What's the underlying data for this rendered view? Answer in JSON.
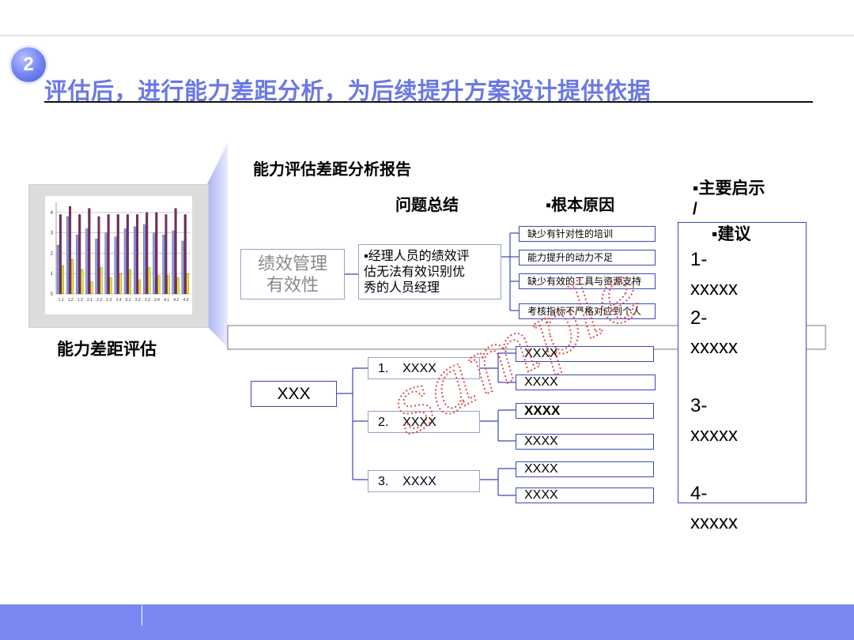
{
  "badge_number": "2",
  "title": "评估后，进行能力差距分析，为后续提升方案设计提供依据",
  "left_caption": "能力差距评估",
  "thumbnail_chart": {
    "type": "bar",
    "y_ticks": [
      "0",
      "1",
      "2",
      "3",
      "4"
    ],
    "x_labels": [
      "1.1",
      "1.2",
      "1.3",
      "2.1",
      "2.2",
      "2.3",
      "2.4",
      "3.1",
      "3.2",
      "3.3",
      "3.4",
      "4.1",
      "4.2",
      "4.3"
    ],
    "series": [
      {
        "values": [
          2.4,
          3.8,
          2.9,
          3.2,
          2.7,
          3.0,
          2.8,
          3.2,
          3.3,
          3.4,
          3.0,
          2.9,
          3.1,
          2.6
        ],
        "color": "#8e9be8"
      },
      {
        "values": [
          3.9,
          4.3,
          3.9,
          4.2,
          3.8,
          3.9,
          3.9,
          3.9,
          3.9,
          4.0,
          4.0,
          3.9,
          4.2,
          3.9
        ],
        "color": "#7a2a5e"
      },
      {
        "values": [
          1.4,
          1.7,
          1.2,
          0.6,
          1.3,
          0.8,
          1.0,
          1.2,
          0.7,
          1.3,
          0.9,
          0.9,
          0.8,
          1.0
        ],
        "color": "#f2e233"
      }
    ],
    "ylim": [
      0,
      4.5
    ]
  },
  "report": {
    "title": "能力评估差距分析报告",
    "col_summary": "问题总结",
    "col_cause": "▪根本原因",
    "col_advice": "▪主要启示\n/",
    "advice_sub": "▪建议",
    "topic": "绩效管理\n有效性",
    "summary": "▪经理人员的绩效评\n估无法有效识别优\n秀的人员经理",
    "causes": [
      "缺少有针对性的培训",
      "能力提升的动力不足",
      "缺少有效的工具与资源支持",
      "考核指标不严格对应到个人"
    ],
    "advice": "1-\nxxxxx\n2-\nxxxxx\n\n3-\nxxxxx\n\n4-\nxxxxx"
  },
  "tree": {
    "root": "XXX",
    "branches": [
      "1.    XXXX",
      "2.    XXXX",
      "3.    XXXX"
    ],
    "leaves": [
      "XXXX",
      "XXXX",
      "XXXX",
      "XXXX",
      "XXXX",
      "XXXX"
    ]
  },
  "watermark": "sample"
}
